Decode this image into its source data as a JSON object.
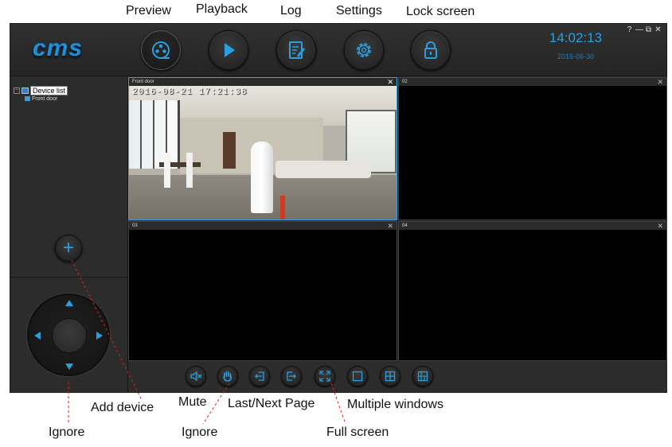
{
  "annotations": {
    "preview": "Preview",
    "playback": "Playback",
    "log": "Log",
    "settings": "Settings",
    "lock_screen": "Lock screen",
    "add_device": "Add device",
    "mute": "Mute",
    "last_next_page": "Last/Next Page",
    "multiple_windows": "Multiple windows",
    "ignore_ptz": "Ignore",
    "ignore_hand": "Ignore",
    "full_screen": "Full screen"
  },
  "app": {
    "logo": "cms",
    "time": "14:02:13",
    "date": "2016-06-30",
    "window_controls": [
      "?",
      "—",
      "⧉",
      "✕"
    ]
  },
  "sidebar": {
    "tree_root": "Device list",
    "tree_child": "Front door"
  },
  "panes": [
    {
      "title": "Front door",
      "close": "✕",
      "selected": true,
      "osd": "2016-08-21  17:21:38"
    },
    {
      "title": "02",
      "close": "✕",
      "selected": false
    },
    {
      "title": "03",
      "close": "✕",
      "selected": false
    },
    {
      "title": "04",
      "close": "✕",
      "selected": false
    }
  ],
  "colors": {
    "accent": "#2a9fe0",
    "background": "#2c2c2c",
    "pane_bg": "#000000",
    "annotation_line": "#d62020"
  },
  "icons": {
    "top": [
      "preview-reel-icon",
      "playback-play-icon",
      "log-notepad-icon",
      "settings-gear-icon",
      "lock-icon"
    ],
    "bottom": [
      "mute-speaker-icon",
      "hand-icon",
      "last-page-icon",
      "next-page-icon",
      "fullscreen-icon",
      "single-window-icon",
      "four-window-icon",
      "multi-window-icon"
    ]
  }
}
